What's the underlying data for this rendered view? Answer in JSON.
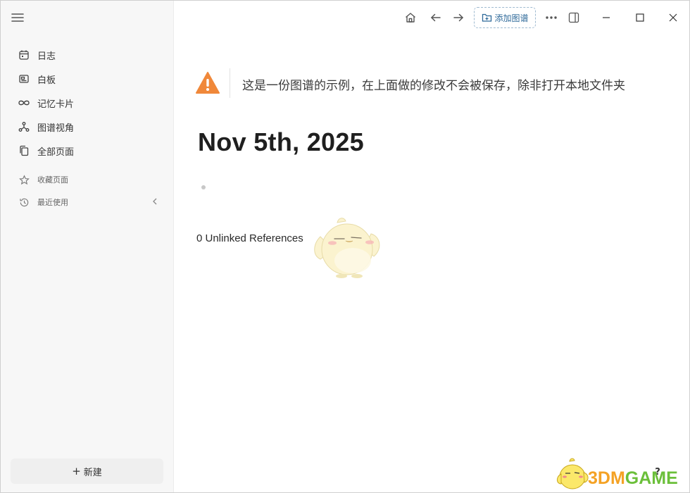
{
  "sidebar": {
    "menu_icon": "hamburger-icon",
    "nav_items": [
      {
        "label": "日志",
        "icon": "calendar-icon"
      },
      {
        "label": "白板",
        "icon": "whiteboard-icon"
      },
      {
        "label": "记忆卡片",
        "icon": "infinity-icon"
      },
      {
        "label": "图谱视角",
        "icon": "graph-icon"
      },
      {
        "label": "全部页面",
        "icon": "pages-icon"
      }
    ],
    "sub_items": [
      {
        "label": "收藏页面",
        "icon": "star-icon"
      },
      {
        "label": "最近使用",
        "icon": "history-icon"
      }
    ],
    "new_button": {
      "plus": "+",
      "label": "新建"
    }
  },
  "toolbar": {
    "add_graph_label": "添加图谱",
    "icons": [
      "home-icon",
      "back-arrow-icon",
      "forward-arrow-icon",
      "more-icon",
      "sidebar-toggle-icon",
      "minimize-icon",
      "maximize-icon",
      "close-icon"
    ]
  },
  "banner": {
    "text": "这是一份图谱的示例，在上面做的修改不会被保存，除非打开本地文件夹",
    "icon": "warning-icon",
    "icon_color": "#f0883a"
  },
  "page": {
    "title": "Nov 5th, 2025",
    "unlinked_references": "0 Unlinked References"
  },
  "help": {
    "label": "?"
  },
  "watermark": {
    "part1": "3DM",
    "part2": "GAME"
  },
  "colors": {
    "sidebar_bg": "#f7f7f7",
    "accent": "#2f6a9a",
    "warning": "#f0883a"
  }
}
